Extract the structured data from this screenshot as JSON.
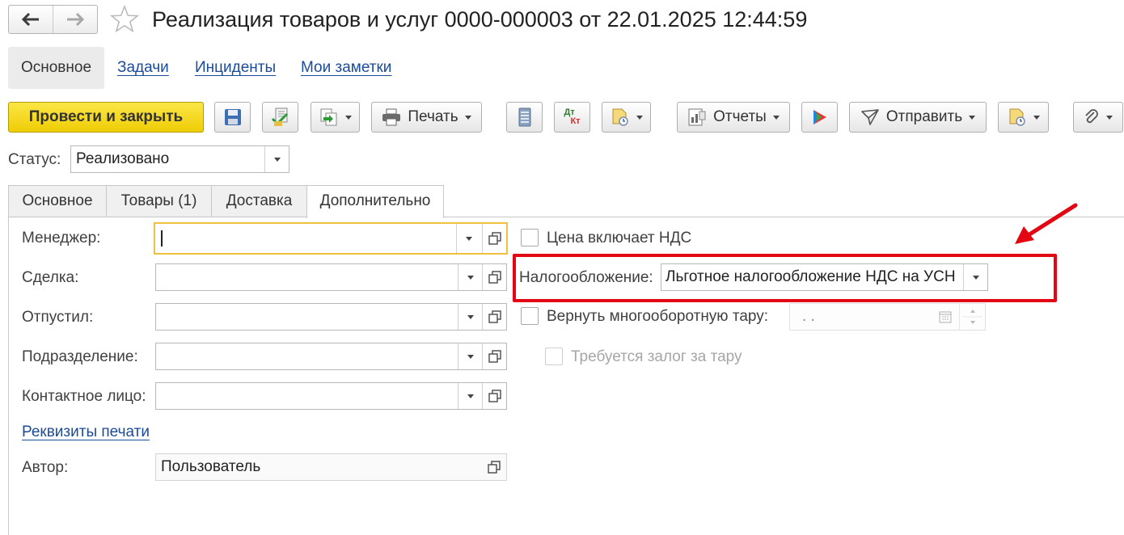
{
  "header": {
    "title": "Реализация товаров и услуг 0000-000003 от 22.01.2025 12:44:59"
  },
  "section_tabs": [
    "Основное",
    "Задачи",
    "Инциденты",
    "Мои заметки"
  ],
  "toolbar": {
    "post_and_close": "Провести и закрыть",
    "print": "Печать",
    "reports": "Отчеты",
    "send": "Отправить",
    "dtkt_top": "Дт",
    "dtkt_bottom": "Кт"
  },
  "status": {
    "label": "Статус:",
    "value": "Реализовано"
  },
  "form_tabs": [
    "Основное",
    "Товары (1)",
    "Доставка",
    "Дополнительно"
  ],
  "left_fields": {
    "manager": "Менеджер:",
    "deal": "Сделка:",
    "released": "Отпустил:",
    "department": "Подразделение:",
    "contact": "Контактное лицо:",
    "print_props_link": "Реквизиты печати",
    "author": "Автор:",
    "author_value": "Пользователь"
  },
  "right_fields": {
    "price_includes_vat": "Цена включает НДС",
    "taxation_label": "Налогообложение:",
    "taxation_value": "Льготное налогообложение НДС на УСН",
    "return_tare": "Вернуть многооборотную тару:",
    "return_tare_date": ".   .",
    "deposit_required": "Требуется залог за тару"
  },
  "colors": {
    "highlight": "#e30613",
    "primary_button": "#f5d823",
    "link": "#1b4b9b",
    "focus_border": "#f0c040"
  }
}
